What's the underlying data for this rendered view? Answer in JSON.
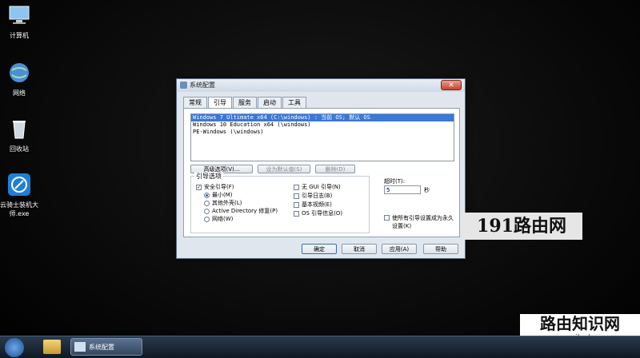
{
  "desktop": {
    "icons": [
      {
        "label": "计算机"
      },
      {
        "label": "网络"
      },
      {
        "label": "回收站"
      },
      {
        "label": "云骑士装机大师.exe"
      }
    ]
  },
  "dialog": {
    "title": "系统配置",
    "close_label": "✕",
    "tabs": [
      "常规",
      "引导",
      "服务",
      "启动",
      "工具"
    ],
    "active_tab": "引导",
    "os_entries": [
      {
        "text": "Windows 7 Ultimate x64 (C:\\windows) : 当前 OS; 默认 OS",
        "selected": true
      },
      {
        "text": "Windows 10 Education x64 (\\windows)",
        "selected": false
      },
      {
        "text": "PE-Windows (\\windows)",
        "selected": false
      }
    ],
    "buttons": {
      "advanced": "高级选项(V)...",
      "set_default": "设为默认值(S)",
      "delete": "删除(D)"
    },
    "boot_options": {
      "title": "引导选项",
      "safe_boot": "安全引导(F)",
      "minimal": "最小(M)",
      "alternate_shell": "其他外壳(L)",
      "active_directory": "Active Directory 修复(P)",
      "network": "网络(W)",
      "no_gui": "无 GUI 引导(N)",
      "boot_log": "引导日志(B)",
      "base_video": "基本视频(E)",
      "os_boot_info": "OS 引导信息(O)"
    },
    "timeout": {
      "label": "超时(T):",
      "value": "5",
      "unit": "秒"
    },
    "permanent": "使所有引导设置成为永久设置(K)",
    "footer": {
      "ok": "确定",
      "cancel": "取消",
      "apply": "应用(A)",
      "help": "帮助"
    }
  },
  "watermarks": {
    "top": "191路由网",
    "bottom_title": "路由知识网",
    "bottom_url": "www.yilanbo.cn"
  },
  "taskbar": {
    "task_label": "系统配置"
  }
}
